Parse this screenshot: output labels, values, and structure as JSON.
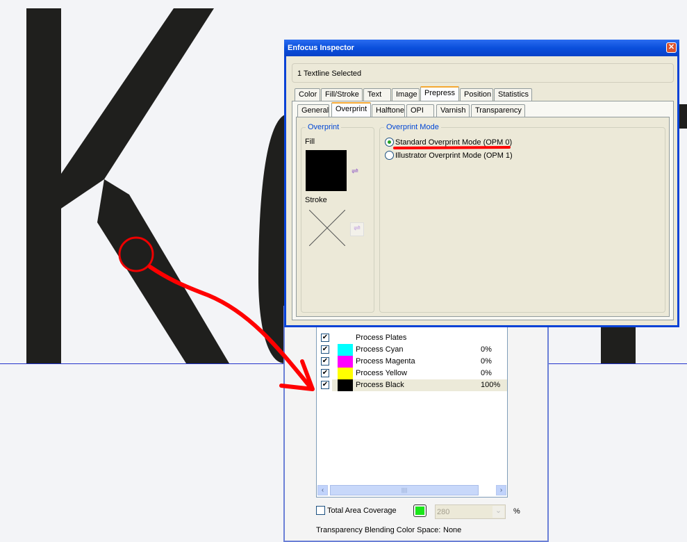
{
  "dialog": {
    "title": "Enfocus Inspector",
    "selection": "1 Textline Selected",
    "tabs": [
      "Color",
      "Fill/Stroke",
      "Text",
      "Image",
      "Prepress",
      "Position",
      "Statistics"
    ],
    "active_tab": "Prepress",
    "subtabs": [
      "General",
      "Overprint",
      "Halftone",
      "OPI",
      "Varnish",
      "Transparency"
    ],
    "active_subtab": "Overprint",
    "overprint_group": "Overprint",
    "fill_label": "Fill",
    "stroke_label": "Stroke",
    "mode_group": "Overprint Mode",
    "modes": [
      {
        "label": "Standard Overprint Mode (OPM 0)",
        "selected": true
      },
      {
        "label": "Illustrator Overprint Mode (OPM 1)",
        "selected": false
      }
    ]
  },
  "separations": {
    "rows": [
      {
        "name": "Process Plates",
        "pct": "",
        "color": "",
        "checked": true
      },
      {
        "name": "Process Cyan",
        "pct": "0%",
        "color": "#00ffff",
        "checked": true
      },
      {
        "name": "Process Magenta",
        "pct": "0%",
        "color": "#ff00ff",
        "checked": true
      },
      {
        "name": "Process Yellow",
        "pct": "0%",
        "color": "#ffff00",
        "checked": true
      },
      {
        "name": "Process Black",
        "pct": "100%",
        "color": "#000000",
        "checked": true
      }
    ],
    "tac_label": "Total Area Coverage",
    "tac_value": "280",
    "tac_unit": "%",
    "tac_color": "#19e619",
    "blend_label": "Transparency Blending Color Space:",
    "blend_value": "None"
  }
}
